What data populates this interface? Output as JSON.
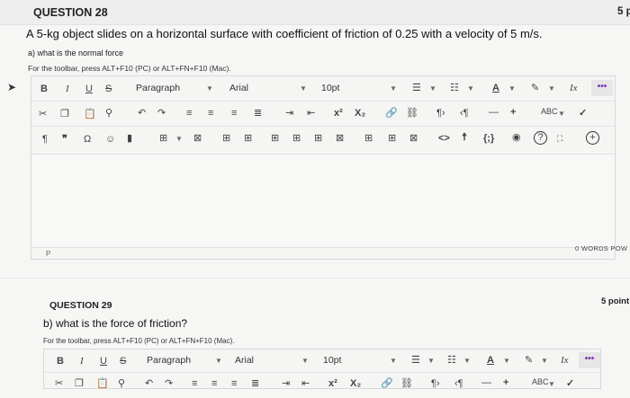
{
  "q28": {
    "title": "QUESTION 28",
    "points": "5 p",
    "question": "A 5-kg object slides on a horizontal surface with coefficient of friction of 0.25 with a velocity of 5 m/s.",
    "sub_a": "a) what is the normal force",
    "hint": "For the toolbar, press ALT+F10 (PC) or ALT+FN+F10 (Mac).",
    "editor": {
      "paragraph": "Paragraph",
      "font": "Arial",
      "size": "10pt",
      "path": "P",
      "words": "0 WORDS",
      "powered": "POW"
    }
  },
  "q29": {
    "title": "QUESTION 29",
    "points": "5 point",
    "question": "b) what is the force of friction?",
    "hint": "For the toolbar, press ALT+F10 (PC) or ALT+FN+F10 (Mac).",
    "editor": {
      "paragraph": "Paragraph",
      "font": "Arial",
      "size": "10pt"
    }
  },
  "glyphs": {
    "bold": "B",
    "italic": "I",
    "underline": "U",
    "strike": "S",
    "superscript": "x²",
    "subscript": "X₂",
    "pilcrow": "¶",
    "quote": "❞",
    "omega": "Ω",
    "more": "•••",
    "code": "<>",
    "braces": "{;}",
    "clear": "Ix",
    "check": "✓",
    "minus": "—",
    "plus": "+",
    "help": "?",
    "cursor": "➤"
  },
  "colors": {
    "accent": "#7a2fbf"
  }
}
